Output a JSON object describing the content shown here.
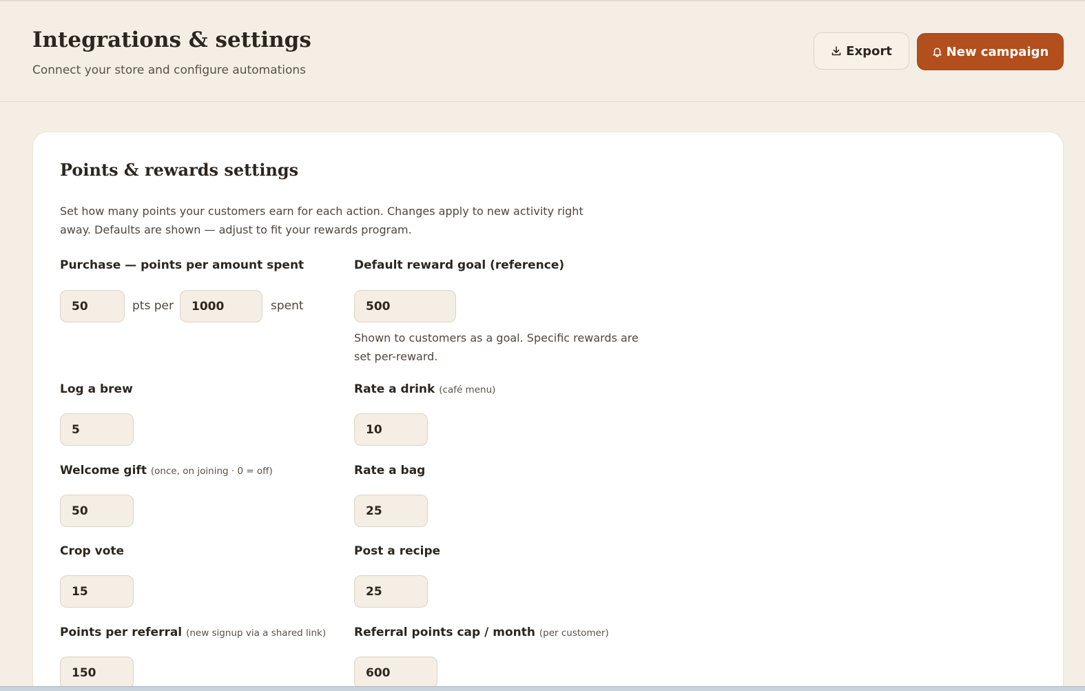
{
  "header": {
    "title": "Integrations & settings",
    "subtitle": "Connect your store and configure automations",
    "export_label": "Export",
    "new_campaign_label": "New campaign"
  },
  "colors": {
    "background": "#f5eee4",
    "accent": "#b24f1d",
    "card": "#ffffff",
    "input_bg": "#f5eee4"
  },
  "icons": {
    "export": "download-icon",
    "new_campaign": "bell-icon"
  },
  "settings": {
    "title": "Points & rewards settings",
    "description": "Set how many points your customers earn for each action. Changes apply to new activity right away. Defaults are shown — adjust to fit your rewards program.",
    "purchase": {
      "label": "Purchase — points per amount spent",
      "points": "50",
      "pts_per_text": "pts per",
      "amount": "1000",
      "spent_text": "spent"
    },
    "reward_goal": {
      "label": "Default reward goal (reference)",
      "value": "500",
      "help": "Shown to customers as a goal. Specific rewards are set per-reward."
    },
    "log_brew": {
      "label": "Log a brew",
      "value": "5"
    },
    "rate_drink": {
      "label": "Rate a drink",
      "hint": "(café menu)",
      "value": "10"
    },
    "welcome_gift": {
      "label": "Welcome gift",
      "hint": "(once, on joining · 0 = off)",
      "value": "50"
    },
    "rate_bag": {
      "label": "Rate a bag",
      "value": "25"
    },
    "crop_vote": {
      "label": "Crop vote",
      "value": "15"
    },
    "post_recipe": {
      "label": "Post a recipe",
      "value": "25"
    },
    "referral_points": {
      "label": "Points per referral",
      "hint": "(new signup via a shared link)",
      "value": "150"
    },
    "referral_cap": {
      "label": "Referral points cap / month",
      "hint": "(per customer)",
      "value": "600"
    }
  }
}
